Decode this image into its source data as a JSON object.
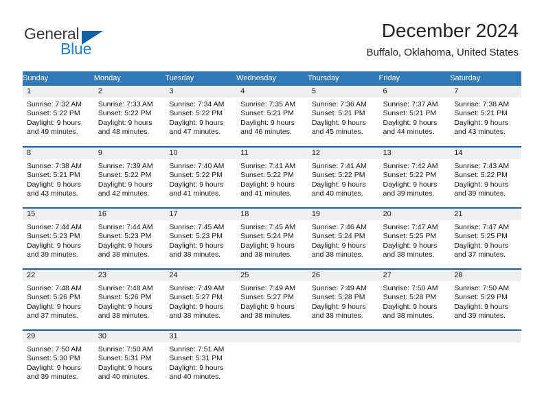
{
  "brand": {
    "name_part1": "General",
    "name_part2": "Blue",
    "accent_color": "#1261a8",
    "blue_text_color": "#1e7bc4"
  },
  "header": {
    "title": "December 2024",
    "subtitle": "Buffalo, Oklahoma, United States"
  },
  "theme": {
    "header_row_bg": "#3079b6",
    "row_divider": "#1a5fa0",
    "daynum_band_bg": "#efefef"
  },
  "weekdays": [
    "Sunday",
    "Monday",
    "Tuesday",
    "Wednesday",
    "Thursday",
    "Friday",
    "Saturday"
  ],
  "weeks": [
    [
      {
        "day": "1",
        "sunrise": "Sunrise: 7:32 AM",
        "sunset": "Sunset: 5:22 PM",
        "daylight_line1": "Daylight: 9 hours",
        "daylight_line2": "and 49 minutes."
      },
      {
        "day": "2",
        "sunrise": "Sunrise: 7:33 AM",
        "sunset": "Sunset: 5:22 PM",
        "daylight_line1": "Daylight: 9 hours",
        "daylight_line2": "and 48 minutes."
      },
      {
        "day": "3",
        "sunrise": "Sunrise: 7:34 AM",
        "sunset": "Sunset: 5:22 PM",
        "daylight_line1": "Daylight: 9 hours",
        "daylight_line2": "and 47 minutes."
      },
      {
        "day": "4",
        "sunrise": "Sunrise: 7:35 AM",
        "sunset": "Sunset: 5:21 PM",
        "daylight_line1": "Daylight: 9 hours",
        "daylight_line2": "and 46 minutes."
      },
      {
        "day": "5",
        "sunrise": "Sunrise: 7:36 AM",
        "sunset": "Sunset: 5:21 PM",
        "daylight_line1": "Daylight: 9 hours",
        "daylight_line2": "and 45 minutes."
      },
      {
        "day": "6",
        "sunrise": "Sunrise: 7:37 AM",
        "sunset": "Sunset: 5:21 PM",
        "daylight_line1": "Daylight: 9 hours",
        "daylight_line2": "and 44 minutes."
      },
      {
        "day": "7",
        "sunrise": "Sunrise: 7:38 AM",
        "sunset": "Sunset: 5:21 PM",
        "daylight_line1": "Daylight: 9 hours",
        "daylight_line2": "and 43 minutes."
      }
    ],
    [
      {
        "day": "8",
        "sunrise": "Sunrise: 7:38 AM",
        "sunset": "Sunset: 5:21 PM",
        "daylight_line1": "Daylight: 9 hours",
        "daylight_line2": "and 43 minutes."
      },
      {
        "day": "9",
        "sunrise": "Sunrise: 7:39 AM",
        "sunset": "Sunset: 5:22 PM",
        "daylight_line1": "Daylight: 9 hours",
        "daylight_line2": "and 42 minutes."
      },
      {
        "day": "10",
        "sunrise": "Sunrise: 7:40 AM",
        "sunset": "Sunset: 5:22 PM",
        "daylight_line1": "Daylight: 9 hours",
        "daylight_line2": "and 41 minutes."
      },
      {
        "day": "11",
        "sunrise": "Sunrise: 7:41 AM",
        "sunset": "Sunset: 5:22 PM",
        "daylight_line1": "Daylight: 9 hours",
        "daylight_line2": "and 41 minutes."
      },
      {
        "day": "12",
        "sunrise": "Sunrise: 7:41 AM",
        "sunset": "Sunset: 5:22 PM",
        "daylight_line1": "Daylight: 9 hours",
        "daylight_line2": "and 40 minutes."
      },
      {
        "day": "13",
        "sunrise": "Sunrise: 7:42 AM",
        "sunset": "Sunset: 5:22 PM",
        "daylight_line1": "Daylight: 9 hours",
        "daylight_line2": "and 39 minutes."
      },
      {
        "day": "14",
        "sunrise": "Sunrise: 7:43 AM",
        "sunset": "Sunset: 5:22 PM",
        "daylight_line1": "Daylight: 9 hours",
        "daylight_line2": "and 39 minutes."
      }
    ],
    [
      {
        "day": "15",
        "sunrise": "Sunrise: 7:44 AM",
        "sunset": "Sunset: 5:23 PM",
        "daylight_line1": "Daylight: 9 hours",
        "daylight_line2": "and 39 minutes."
      },
      {
        "day": "16",
        "sunrise": "Sunrise: 7:44 AM",
        "sunset": "Sunset: 5:23 PM",
        "daylight_line1": "Daylight: 9 hours",
        "daylight_line2": "and 38 minutes."
      },
      {
        "day": "17",
        "sunrise": "Sunrise: 7:45 AM",
        "sunset": "Sunset: 5:23 PM",
        "daylight_line1": "Daylight: 9 hours",
        "daylight_line2": "and 38 minutes."
      },
      {
        "day": "18",
        "sunrise": "Sunrise: 7:45 AM",
        "sunset": "Sunset: 5:24 PM",
        "daylight_line1": "Daylight: 9 hours",
        "daylight_line2": "and 38 minutes."
      },
      {
        "day": "19",
        "sunrise": "Sunrise: 7:46 AM",
        "sunset": "Sunset: 5:24 PM",
        "daylight_line1": "Daylight: 9 hours",
        "daylight_line2": "and 38 minutes."
      },
      {
        "day": "20",
        "sunrise": "Sunrise: 7:47 AM",
        "sunset": "Sunset: 5:25 PM",
        "daylight_line1": "Daylight: 9 hours",
        "daylight_line2": "and 38 minutes."
      },
      {
        "day": "21",
        "sunrise": "Sunrise: 7:47 AM",
        "sunset": "Sunset: 5:25 PM",
        "daylight_line1": "Daylight: 9 hours",
        "daylight_line2": "and 37 minutes."
      }
    ],
    [
      {
        "day": "22",
        "sunrise": "Sunrise: 7:48 AM",
        "sunset": "Sunset: 5:26 PM",
        "daylight_line1": "Daylight: 9 hours",
        "daylight_line2": "and 37 minutes."
      },
      {
        "day": "23",
        "sunrise": "Sunrise: 7:48 AM",
        "sunset": "Sunset: 5:26 PM",
        "daylight_line1": "Daylight: 9 hours",
        "daylight_line2": "and 38 minutes."
      },
      {
        "day": "24",
        "sunrise": "Sunrise: 7:49 AM",
        "sunset": "Sunset: 5:27 PM",
        "daylight_line1": "Daylight: 9 hours",
        "daylight_line2": "and 38 minutes."
      },
      {
        "day": "25",
        "sunrise": "Sunrise: 7:49 AM",
        "sunset": "Sunset: 5:27 PM",
        "daylight_line1": "Daylight: 9 hours",
        "daylight_line2": "and 38 minutes."
      },
      {
        "day": "26",
        "sunrise": "Sunrise: 7:49 AM",
        "sunset": "Sunset: 5:28 PM",
        "daylight_line1": "Daylight: 9 hours",
        "daylight_line2": "and 38 minutes."
      },
      {
        "day": "27",
        "sunrise": "Sunrise: 7:50 AM",
        "sunset": "Sunset: 5:28 PM",
        "daylight_line1": "Daylight: 9 hours",
        "daylight_line2": "and 38 minutes."
      },
      {
        "day": "28",
        "sunrise": "Sunrise: 7:50 AM",
        "sunset": "Sunset: 5:29 PM",
        "daylight_line1": "Daylight: 9 hours",
        "daylight_line2": "and 39 minutes."
      }
    ],
    [
      {
        "day": "29",
        "sunrise": "Sunrise: 7:50 AM",
        "sunset": "Sunset: 5:30 PM",
        "daylight_line1": "Daylight: 9 hours",
        "daylight_line2": "and 39 minutes."
      },
      {
        "day": "30",
        "sunrise": "Sunrise: 7:50 AM",
        "sunset": "Sunset: 5:31 PM",
        "daylight_line1": "Daylight: 9 hours",
        "daylight_line2": "and 40 minutes."
      },
      {
        "day": "31",
        "sunrise": "Sunrise: 7:51 AM",
        "sunset": "Sunset: 5:31 PM",
        "daylight_line1": "Daylight: 9 hours",
        "daylight_line2": "and 40 minutes."
      },
      {
        "day": "",
        "sunrise": "",
        "sunset": "",
        "daylight_line1": "",
        "daylight_line2": ""
      },
      {
        "day": "",
        "sunrise": "",
        "sunset": "",
        "daylight_line1": "",
        "daylight_line2": ""
      },
      {
        "day": "",
        "sunrise": "",
        "sunset": "",
        "daylight_line1": "",
        "daylight_line2": ""
      },
      {
        "day": "",
        "sunrise": "",
        "sunset": "",
        "daylight_line1": "",
        "daylight_line2": ""
      }
    ]
  ]
}
